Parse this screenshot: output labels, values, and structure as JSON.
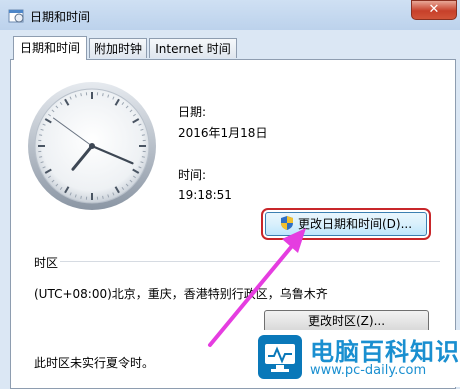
{
  "window": {
    "title": "日期和时间",
    "close_glyph": "✕"
  },
  "tabs": [
    {
      "label": "日期和时间",
      "active": true
    },
    {
      "label": "附加时钟",
      "active": false
    },
    {
      "label": "Internet 时间",
      "active": false
    }
  ],
  "clock": {
    "hour": 7,
    "minute": 18,
    "second": 51
  },
  "date": {
    "label": "日期:",
    "value": "2016年1月18日"
  },
  "time": {
    "label": "时间:",
    "value": "19:18:51"
  },
  "change_datetime_button": "更改日期和时间(D)...",
  "timezone": {
    "heading": "时区",
    "value": "(UTC+08:00)北京，重庆，香港特别行政区，乌鲁木齐",
    "change_button": "更改时区(Z)..."
  },
  "dst_note": "此时区未实行夏令时。",
  "watermark": {
    "title": "电脑百科知识",
    "url": "www.pc-daily.com"
  },
  "colors": {
    "arrow": "#e53de0",
    "highlight": "#c8262a",
    "brand": "#1a8fd0"
  }
}
